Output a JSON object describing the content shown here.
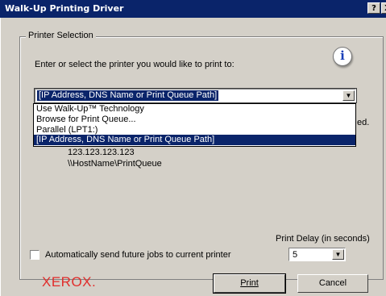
{
  "window": {
    "title": "Walk-Up Printing Driver",
    "help_label": "?",
    "close_label": "X"
  },
  "printer_selection": {
    "legend": "Printer Selection",
    "prompt": "Enter or select the printer you would like to print to:",
    "info_icon": "i",
    "selected_value": "[IP Address, DNS Name or Print Queue Path]",
    "options": [
      "Use Walk-Up™ Technology",
      "Browse for Print Queue...",
      "Parallel (LPT1:)",
      "[IP Address, DNS Name or Print Queue Path]"
    ],
    "active_option_index": 3,
    "obscured_trailing_text": "ed.",
    "examples": [
      "123.123.123.123",
      "\\\\HostName\\PrintQueue"
    ]
  },
  "auto_send": {
    "label": "Automatically send future jobs to current printer",
    "checked": false
  },
  "print_delay": {
    "label": "Print Delay (in seconds)",
    "value": "5"
  },
  "footer": {
    "brand": "XEROX.",
    "print_button": "Print",
    "cancel_button": "Cancel"
  },
  "colors": {
    "titlebar": "#0a246a",
    "selection": "#0a246a",
    "dialog_bg": "#d4d0c8",
    "brand": "#e12d2b"
  }
}
